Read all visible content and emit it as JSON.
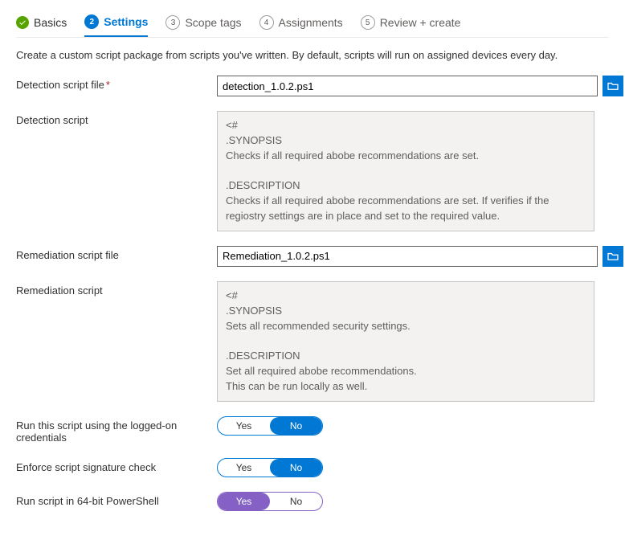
{
  "stepper": {
    "step1": "Basics",
    "step2": "Settings",
    "step3_num": "3",
    "step3": "Scope tags",
    "step4_num": "4",
    "step4": "Assignments",
    "step5_num": "5",
    "step5": "Review + create",
    "active_num": "2"
  },
  "intro": "Create a custom script package from scripts you've written. By default, scripts will run on assigned devices every day.",
  "labels": {
    "detect_file": "Detection script file",
    "detect_script": "Detection script",
    "remed_file": "Remediation script file",
    "remed_script": "Remediation script",
    "run_logged": "Run this script using the logged-on credentials",
    "enforce_sig": "Enforce script signature check",
    "run_64": "Run script in 64-bit PowerShell",
    "required": "*"
  },
  "vals": {
    "detect_file": "detection_1.0.2.ps1",
    "detect_script": "<#\n.SYNOPSIS\nChecks if all required abobe recommendations are set.\n\n.DESCRIPTION\nChecks if all required abobe recommendations are set. If verifies if the regiostry settings are in place and set to the required value.",
    "remed_file": "Remediation_1.0.2.ps1",
    "remed_script": "<#\n.SYNOPSIS\nSets all recommended security settings.\n\n.DESCRIPTION\nSet all required abobe recommendations.\nThis can be run locally as well."
  },
  "toggle": {
    "yes": "Yes",
    "no": "No"
  }
}
